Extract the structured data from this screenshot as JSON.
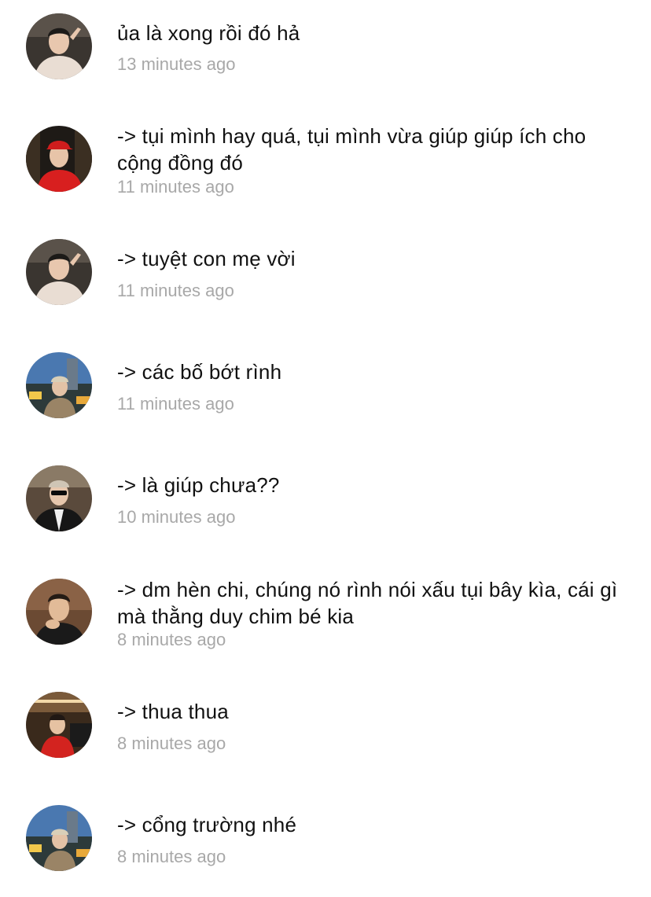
{
  "comments": [
    {
      "text": "ủa là xong rồi đó hả",
      "time": "13 minutes ago",
      "avatar": "avatar-man-peace-sign-icon"
    },
    {
      "text": "-> tụi mình hay quá, tụi mình vừa giúp giúp ích cho cộng đồng đó",
      "time": "11 minutes ago",
      "avatar": "avatar-man-red-cap-icon"
    },
    {
      "text": "-> tuyệt con mẹ vời",
      "time": "11 minutes ago",
      "avatar": "avatar-man-peace-sign-icon"
    },
    {
      "text": "-> các bố bớt rình",
      "time": "11 minutes ago",
      "avatar": "avatar-man-city-night-icon"
    },
    {
      "text": "-> là giúp chưa??",
      "time": "10 minutes ago",
      "avatar": "avatar-man-sunglasses-icon"
    },
    {
      "text": "-> dm hèn chi, chúng nó rình nói xấu tụi bây kìa, cái gì mà thằng duy chim bé kia",
      "time": "8 minutes ago",
      "avatar": "avatar-man-hand-chin-icon"
    },
    {
      "text": "-> thua thua",
      "time": "8 minutes ago",
      "avatar": "avatar-man-red-shirt-studio-icon"
    },
    {
      "text": "-> cổng trường nhé",
      "time": "8 minutes ago",
      "avatar": "avatar-man-city-night-icon"
    }
  ]
}
